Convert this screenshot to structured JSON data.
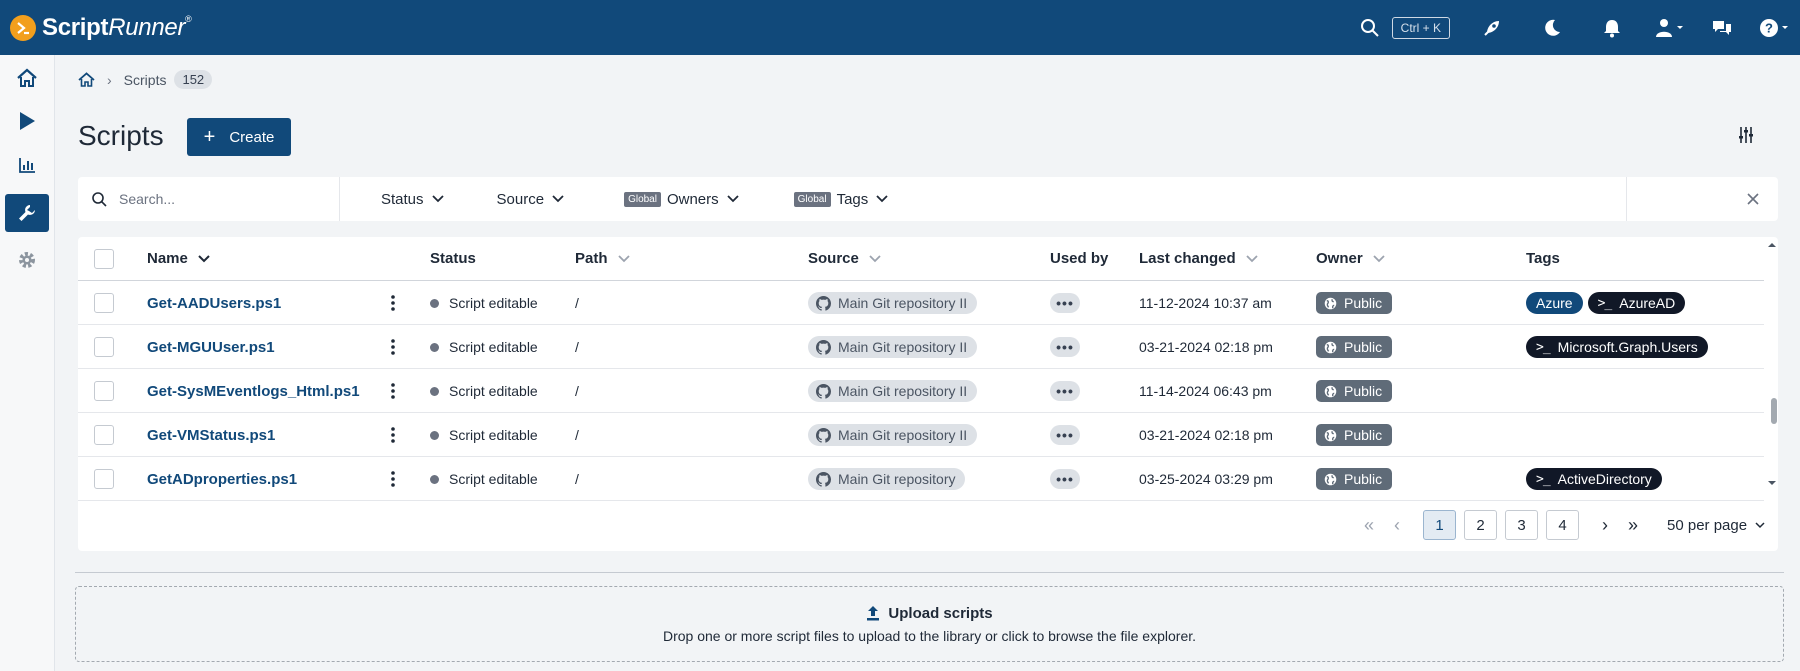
{
  "brand": {
    "name_bold": "Script",
    "name_italic": "Runner",
    "reg": "®"
  },
  "header": {
    "shortcut": "Ctrl + K"
  },
  "breadcrumb": {
    "current": "Scripts",
    "count": "152"
  },
  "page": {
    "title": "Scripts",
    "create_label": "Create"
  },
  "filters": {
    "search_placeholder": "Search...",
    "status": "Status",
    "source": "Source",
    "global_label": "Global",
    "owners": "Owners",
    "tags": "Tags"
  },
  "table": {
    "columns": {
      "name": "Name",
      "status": "Status",
      "path": "Path",
      "source": "Source",
      "used_by": "Used by",
      "last_changed": "Last changed",
      "owner": "Owner",
      "tags": "Tags"
    },
    "rows": [
      {
        "name": "Get-AADUsers.ps1",
        "status": "Script editable",
        "path": "/",
        "source": "Main Git repository II",
        "used_by": "•••",
        "last_changed": "11-12-2024 10:37 am",
        "owner": "Public",
        "tags": [
          {
            "label": "Azure",
            "style": "blue",
            "ps": false
          },
          {
            "label": "AzureAD",
            "style": "dark",
            "ps": true
          }
        ]
      },
      {
        "name": "Get-MGUUser.ps1",
        "status": "Script editable",
        "path": "/",
        "source": "Main Git repository II",
        "used_by": "•••",
        "last_changed": "03-21-2024 02:18 pm",
        "owner": "Public",
        "tags": [
          {
            "label": "Microsoft.Graph.Users",
            "style": "dark",
            "ps": true
          }
        ]
      },
      {
        "name": "Get-SysMEventlogs_Html.ps1",
        "status": "Script editable",
        "path": "/",
        "source": "Main Git repository II",
        "used_by": "•••",
        "last_changed": "11-14-2024 06:43 pm",
        "owner": "Public",
        "tags": []
      },
      {
        "name": "Get-VMStatus.ps1",
        "status": "Script editable",
        "path": "/",
        "source": "Main Git repository II",
        "used_by": "•••",
        "last_changed": "03-21-2024 02:18 pm",
        "owner": "Public",
        "tags": []
      },
      {
        "name": "GetADproperties.ps1",
        "status": "Script editable",
        "path": "/",
        "source": "Main Git repository",
        "used_by": "•••",
        "last_changed": "03-25-2024 03:29 pm",
        "owner": "Public",
        "tags": [
          {
            "label": "ActiveDirectory",
            "style": "dark",
            "ps": true
          }
        ]
      }
    ]
  },
  "pagination": {
    "pages": [
      "1",
      "2",
      "3",
      "4"
    ],
    "current": "1",
    "per_page": "50 per page"
  },
  "upload": {
    "title": "Upload scripts",
    "description": "Drop one or more script files to upload to the library or click to browse the file explorer."
  },
  "colors": {
    "brand": "#11497a",
    "logo": "#f29f1d",
    "status_dot": "#6b7280",
    "owner_pill": "#5f6b78",
    "tag_dark": "#111827"
  }
}
